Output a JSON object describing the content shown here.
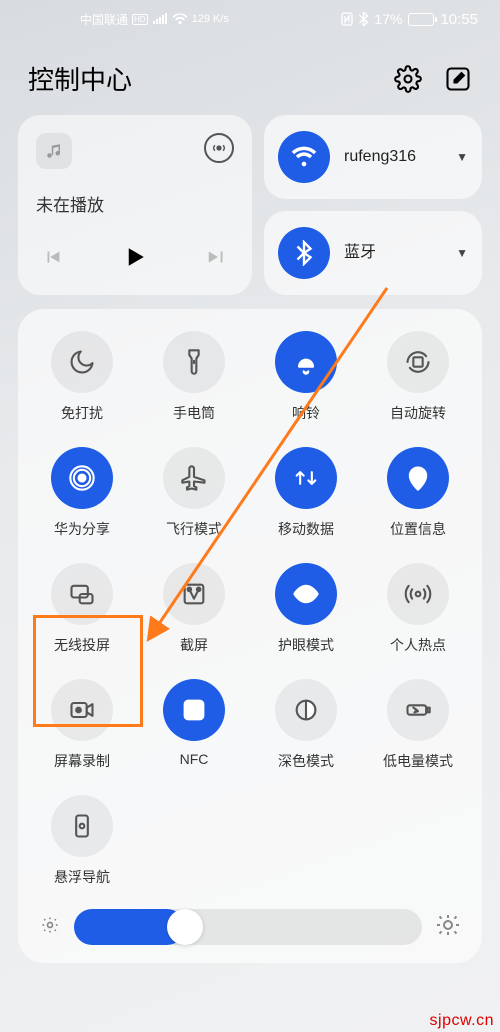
{
  "status": {
    "carrier": "中国联通",
    "speed": "129 K/s",
    "battery_pct": "17%",
    "time": "10:55"
  },
  "header": {
    "title": "控制中心"
  },
  "music": {
    "status": "未在播放"
  },
  "wifi": {
    "ssid": "rufeng316"
  },
  "bluetooth": {
    "label": "蓝牙"
  },
  "tiles": [
    {
      "label": "免打扰",
      "state": "off",
      "icon": "moon"
    },
    {
      "label": "手电筒",
      "state": "off",
      "icon": "flashlight"
    },
    {
      "label": "响铃",
      "state": "on",
      "icon": "bell"
    },
    {
      "label": "自动旋转",
      "state": "off",
      "icon": "rotate"
    },
    {
      "label": "华为分享",
      "state": "on",
      "icon": "share"
    },
    {
      "label": "飞行模式",
      "state": "off",
      "icon": "airplane"
    },
    {
      "label": "移动数据",
      "state": "on",
      "icon": "data"
    },
    {
      "label": "位置信息",
      "state": "on",
      "icon": "location"
    },
    {
      "label": "无线投屏",
      "state": "off",
      "icon": "cast"
    },
    {
      "label": "截屏",
      "state": "off",
      "icon": "screenshot"
    },
    {
      "label": "护眼模式",
      "state": "on",
      "icon": "eye"
    },
    {
      "label": "个人热点",
      "state": "off",
      "icon": "hotspot"
    },
    {
      "label": "屏幕录制",
      "state": "off",
      "icon": "record"
    },
    {
      "label": "NFC",
      "state": "on",
      "icon": "nfc"
    },
    {
      "label": "深色模式",
      "state": "off",
      "icon": "dark"
    },
    {
      "label": "低电量模式",
      "state": "off",
      "icon": "lowbatt"
    },
    {
      "label": "悬浮导航",
      "state": "off",
      "icon": "floatnav"
    }
  ],
  "annotation": {
    "highlight_tile_index": 8,
    "watermark": "sjpcw.cn"
  },
  "colors": {
    "accent": "#1f5de6",
    "highlight": "#ff7a1a"
  }
}
